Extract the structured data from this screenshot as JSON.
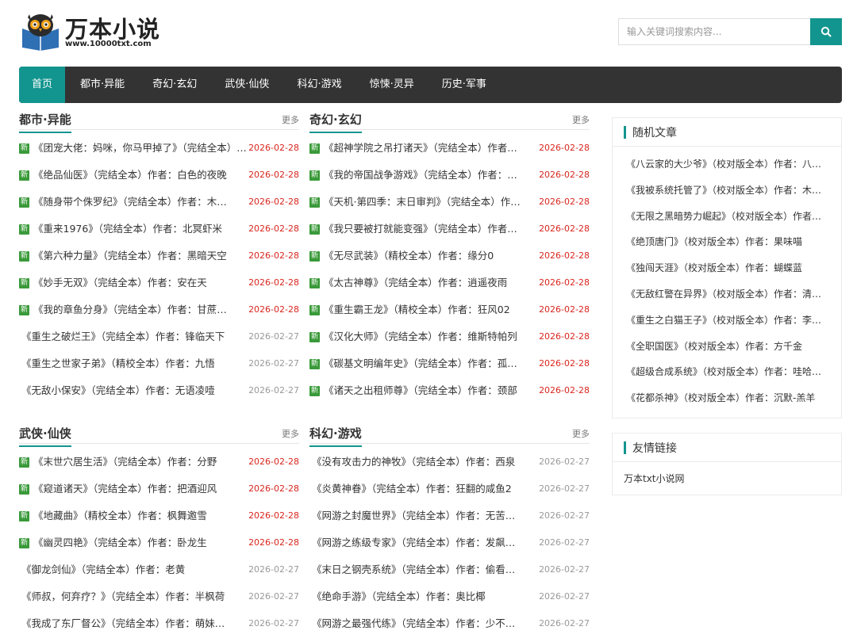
{
  "site": {
    "name": "万本小说",
    "url": "www.10000txt.com"
  },
  "search": {
    "placeholder": "输入关键词搜索内容..."
  },
  "nav": [
    "首页",
    "都市·异能",
    "奇幻·玄幻",
    "武侠·仙侠",
    "科幻·游戏",
    "惊悚·灵异",
    "历史·军事"
  ],
  "more_label": "更多",
  "new_badge": "新",
  "sections": [
    {
      "title": "都市·异能",
      "items": [
        {
          "text": "《团宠大佬：妈咪，你马甲掉了》（完结全本）作者：…",
          "date": "2026-02-28",
          "new": true
        },
        {
          "text": "《绝品仙医》（完结全本）作者：白色的夜晚",
          "date": "2026-02-28",
          "new": true
        },
        {
          "text": "《随身带个侏罗纪》（完结全本）作者：木…",
          "date": "2026-02-28",
          "new": true
        },
        {
          "text": "《重来1976》（完结全本）作者：北冥虾米",
          "date": "2026-02-28",
          "new": true
        },
        {
          "text": "《第六种力量》（完结全本）作者：黑暗天空",
          "date": "2026-02-28",
          "new": true
        },
        {
          "text": "《妙手无双》（完结全本）作者：安在天",
          "date": "2026-02-28",
          "new": true
        },
        {
          "text": "《我的章鱼分身》（完结全本）作者：甘蔗…",
          "date": "2026-02-28",
          "new": true
        },
        {
          "text": "《重生之破烂王》（完结全本）作者：锋临天下",
          "date": "2026-02-27",
          "new": false
        },
        {
          "text": "《重生之世家子弟》（精校全本）作者：九悟",
          "date": "2026-02-27",
          "new": false
        },
        {
          "text": "《无敌小保安》（完结全本）作者：无语凌噎",
          "date": "2026-02-27",
          "new": false
        }
      ]
    },
    {
      "title": "奇幻·玄幻",
      "items": [
        {
          "text": "《超神学院之吊打诸天》（完结全本）作者…",
          "date": "2026-02-28",
          "new": true
        },
        {
          "text": "《我的帝国战争游戏》（完结全本）作者：…",
          "date": "2026-02-28",
          "new": true
        },
        {
          "text": "《天机·第四季：末日审判》（完结全本）作…",
          "date": "2026-02-28",
          "new": true
        },
        {
          "text": "《我只要被打就能变强》（完结全本）作者…",
          "date": "2026-02-28",
          "new": true
        },
        {
          "text": "《无尽武装》（精校全本）作者：缘分0",
          "date": "2026-02-28",
          "new": true
        },
        {
          "text": "《太古神尊》（完结全本）作者：逍遥夜雨",
          "date": "2026-02-28",
          "new": true
        },
        {
          "text": "《重生霸王龙》（精校全本）作者：狂风02",
          "date": "2026-02-28",
          "new": true
        },
        {
          "text": "《汉化大师》（完结全本）作者：维斯特帕列",
          "date": "2026-02-28",
          "new": true
        },
        {
          "text": "《碳基文明编年史》（完结全本）作者：孤…",
          "date": "2026-02-28",
          "new": true
        },
        {
          "text": "《诸天之出租师尊》（完结全本）作者：颈部",
          "date": "2026-02-28",
          "new": true
        }
      ]
    },
    {
      "title": "武侠·仙侠",
      "items": [
        {
          "text": "《末世穴居生活》（完结全本）作者：分野",
          "date": "2026-02-28",
          "new": true
        },
        {
          "text": "《窥道诸天》（完结全本）作者：把酒迎风",
          "date": "2026-02-28",
          "new": true
        },
        {
          "text": "《地藏曲》（精校全本）作者：枫舞邀雪",
          "date": "2026-02-28",
          "new": true
        },
        {
          "text": "《幽灵四艳》（完结全本）作者：卧龙生",
          "date": "2026-02-28",
          "new": true
        },
        {
          "text": "《御龙剑仙》（完结全本）作者：老黄",
          "date": "2026-02-27",
          "new": false
        },
        {
          "text": "《师叔，何弃疗？》（完结全本）作者：半枫荷",
          "date": "2026-02-27",
          "new": false
        },
        {
          "text": "《我成了东厂督公》（完结全本）作者：萌妹…",
          "date": "2026-02-27",
          "new": false
        }
      ]
    },
    {
      "title": "科幻·游戏",
      "items": [
        {
          "text": "《没有攻击力的神牧》（完结全本）作者：西泉",
          "date": "2026-02-27",
          "new": false
        },
        {
          "text": "《炎黄神眷》（完结全本）作者：狂翻的咸鱼2",
          "date": "2026-02-27",
          "new": false
        },
        {
          "text": "《网游之封魔世界》（完结全本）作者：无苦…",
          "date": "2026-02-27",
          "new": false
        },
        {
          "text": "《网游之练级专家》（完结全本）作者：发飙…",
          "date": "2026-02-27",
          "new": false
        },
        {
          "text": "《末日之钢壳系统》（完结全本）作者：偷看…",
          "date": "2026-02-27",
          "new": false
        },
        {
          "text": "《绝命手游》（完结全本）作者：奥比椰",
          "date": "2026-02-27",
          "new": false
        },
        {
          "text": "《网游之最强代练》（完结全本）作者：少不…",
          "date": "2026-02-27",
          "new": false
        }
      ]
    }
  ],
  "random": {
    "title": "随机文章",
    "items": [
      "《八云家的大少爷》（校对版全本）作者：八…",
      "《我被系统托管了》（校对版全本）作者：木…",
      "《无限之黑暗势力崛起》（校对版全本）作者…",
      "《绝顶唐门》（校对版全本）作者：果味喵",
      "《独闯天涯》（校对版全本）作者：蝴蝶蓝",
      "《无敌红警在异界》（校对版全本）作者：清…",
      "《重生之白猫王子》（校对版全本）作者：李…",
      "《全职国医》（校对版全本）作者：方千金",
      "《超级合成系统》（校对版全本）作者：哇哈…",
      "《花都杀神》（校对版全本）作者：沉默-羔羊"
    ]
  },
  "links": {
    "title": "友情链接",
    "items": [
      "万本txt小说网"
    ]
  },
  "colors": {
    "accent": "#13958f",
    "nav_bg": "#333333",
    "new_date": "#d8261e",
    "badge": "#3a9a3a"
  }
}
